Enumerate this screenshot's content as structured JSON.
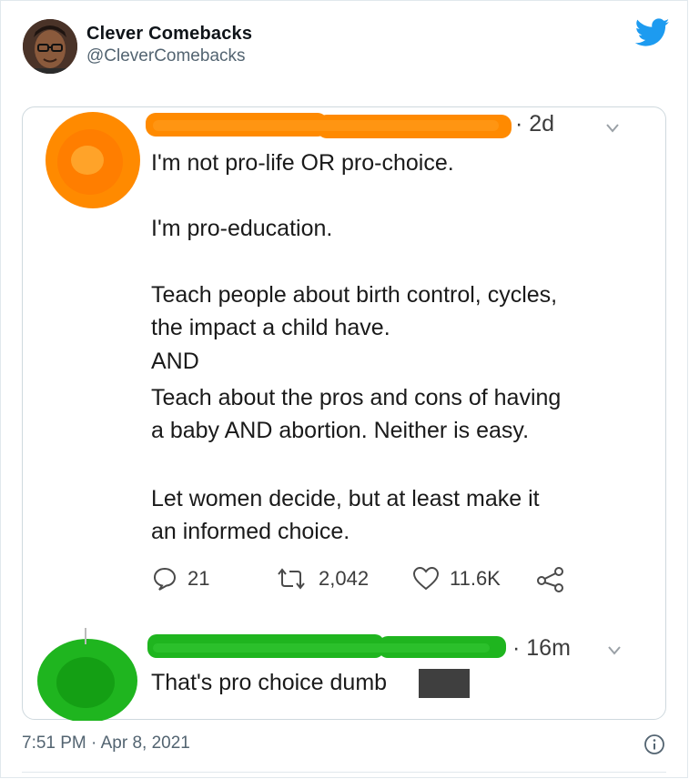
{
  "tweet": {
    "display_name": "Clever Comebacks",
    "handle": "@CleverComebacks",
    "timestamp": "7:51 PM · Apr 8, 2021",
    "brand_color": "#1d9bf0",
    "icons": {
      "brand": "twitter-bird-icon",
      "info": "info-icon"
    }
  },
  "screenshot": {
    "post": {
      "age": "· 2d",
      "lines": [
        "I'm not pro-life OR pro-choice.",
        "I'm pro-education.",
        "Teach people about birth control, cycles,",
        "the impact a child have.",
        "AND",
        "Teach about the pros and cons of having",
        "a baby AND abortion. Neither is easy.",
        "Let women decide, but at least make it",
        "an informed choice."
      ],
      "actions": {
        "replies": "21",
        "retweets": "2,042",
        "likes": "11.6K"
      }
    },
    "reply": {
      "age": "· 16m",
      "text": "That's pro choice dumb"
    },
    "scribble_colors": {
      "orange": "#ff8a00",
      "green": "#1fb51f"
    }
  }
}
